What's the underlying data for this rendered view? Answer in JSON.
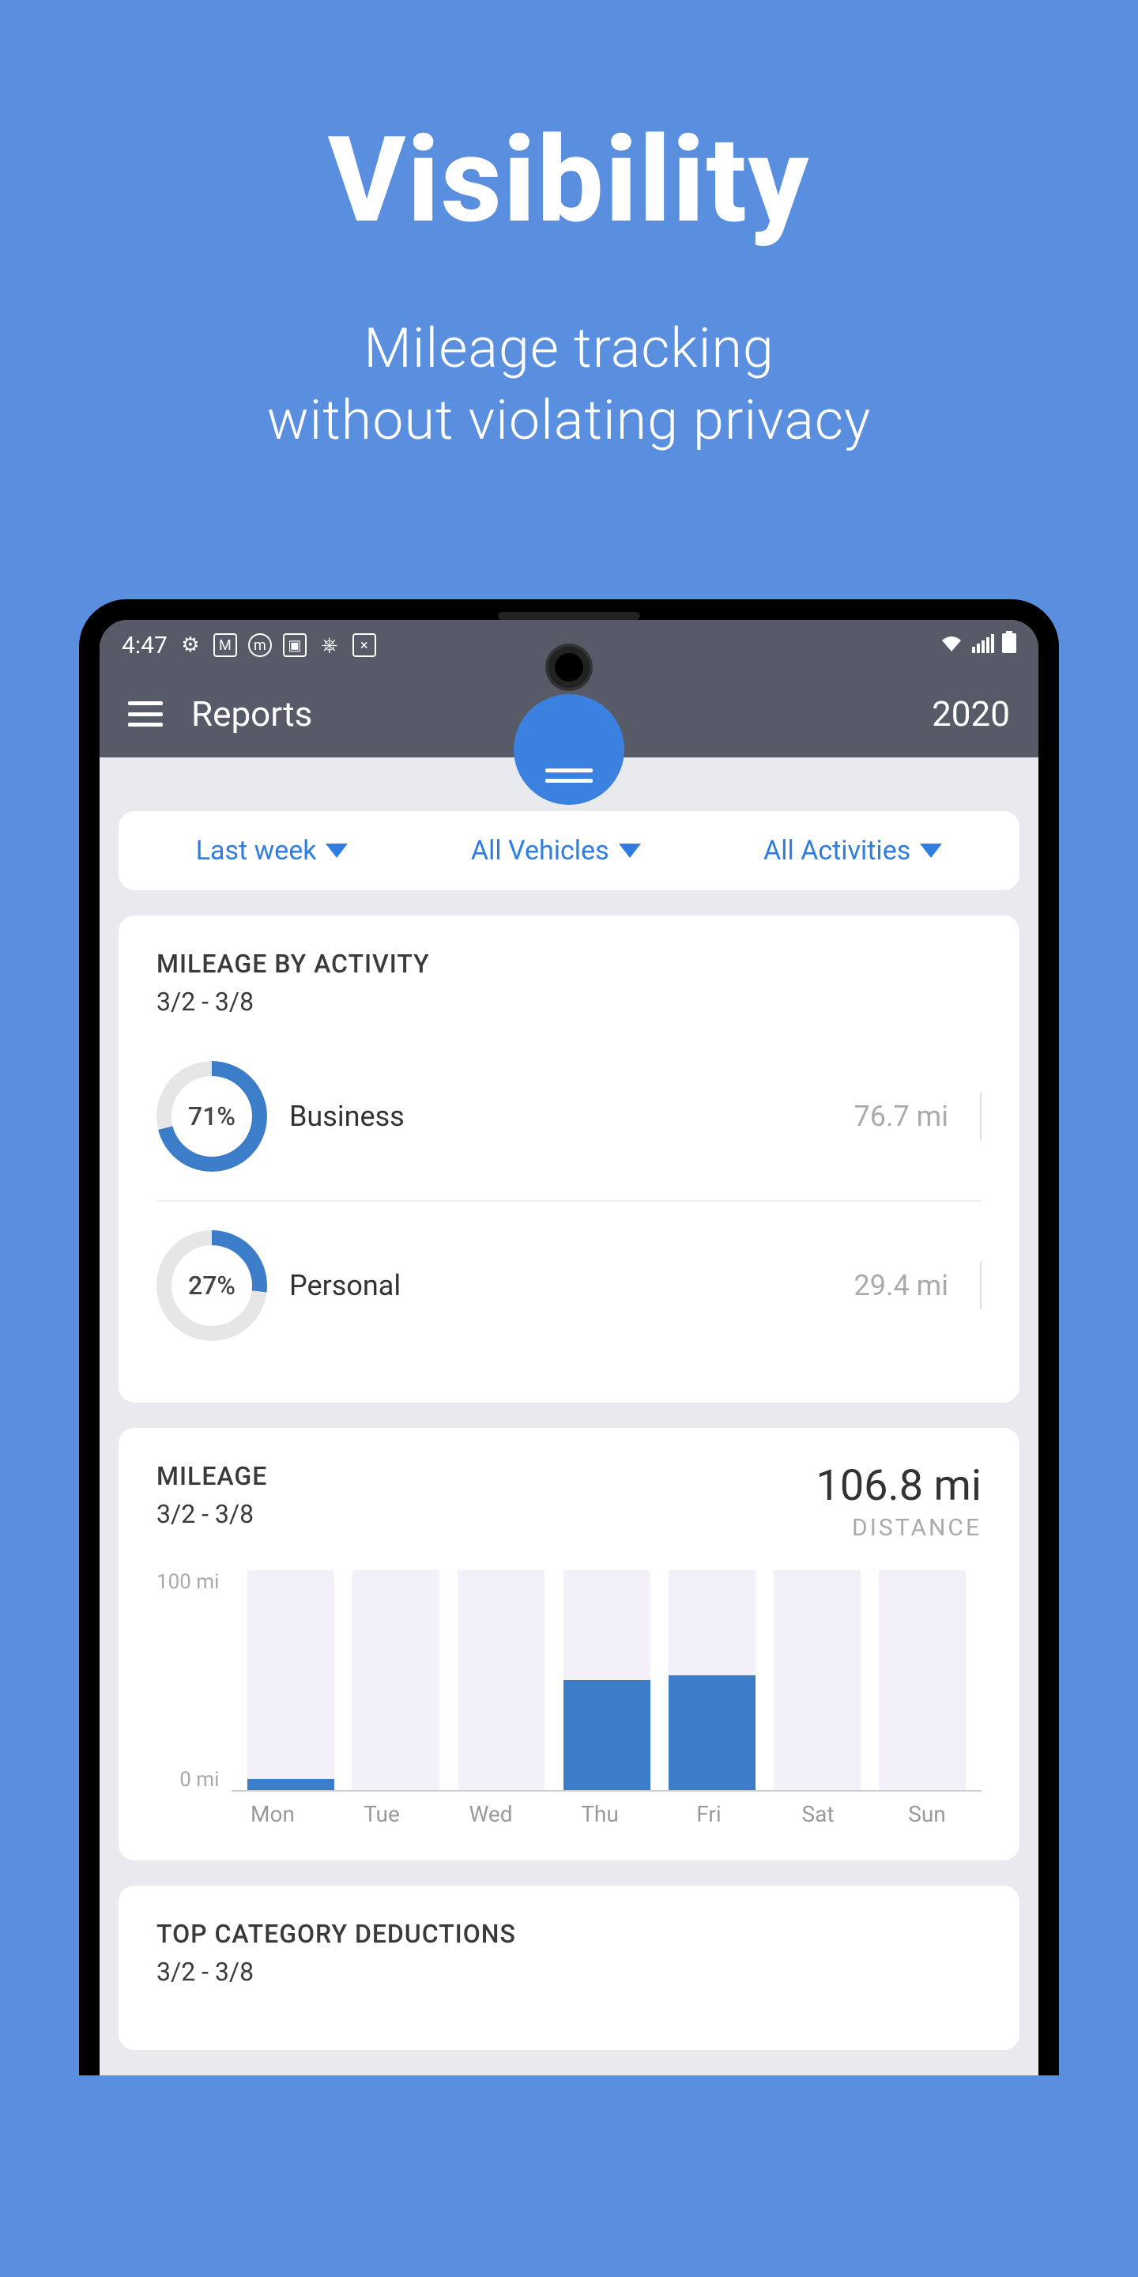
{
  "hero": {
    "title": "Visibility",
    "subtitle_line1": "Mileage tracking",
    "subtitle_line2": "without violating privacy"
  },
  "status_bar": {
    "time": "4:47"
  },
  "app_bar": {
    "title": "Reports",
    "year": "2020"
  },
  "filters": {
    "period": "Last week",
    "vehicles": "All Vehicles",
    "activities": "All Activities"
  },
  "activity_card": {
    "title": "MILEAGE BY ACTIVITY",
    "date_range": "3/2 - 3/8",
    "rows": [
      {
        "percent": 71,
        "percent_label": "71%",
        "label": "Business",
        "miles": "76.7 mi"
      },
      {
        "percent": 27,
        "percent_label": "27%",
        "label": "Personal",
        "miles": "29.4 mi"
      }
    ]
  },
  "mileage_card": {
    "title": "MILEAGE",
    "date_range": "3/2 - 3/8",
    "total": "106.8 mi",
    "distance_label": "DISTANCE",
    "y_top": "100 mi",
    "y_bottom": "0 mi"
  },
  "deductions_card": {
    "title": "TOP CATEGORY DEDUCTIONS",
    "date_range": "3/2 - 3/8"
  },
  "chart_data": {
    "type": "bar",
    "title": "MILEAGE 3/2 - 3/8",
    "xlabel": "",
    "ylabel": "",
    "ylim": [
      0,
      100
    ],
    "categories": [
      "Mon",
      "Tue",
      "Wed",
      "Thu",
      "Fri",
      "Sat",
      "Sun"
    ],
    "values": [
      5,
      0,
      0,
      50,
      52,
      0,
      0
    ]
  }
}
